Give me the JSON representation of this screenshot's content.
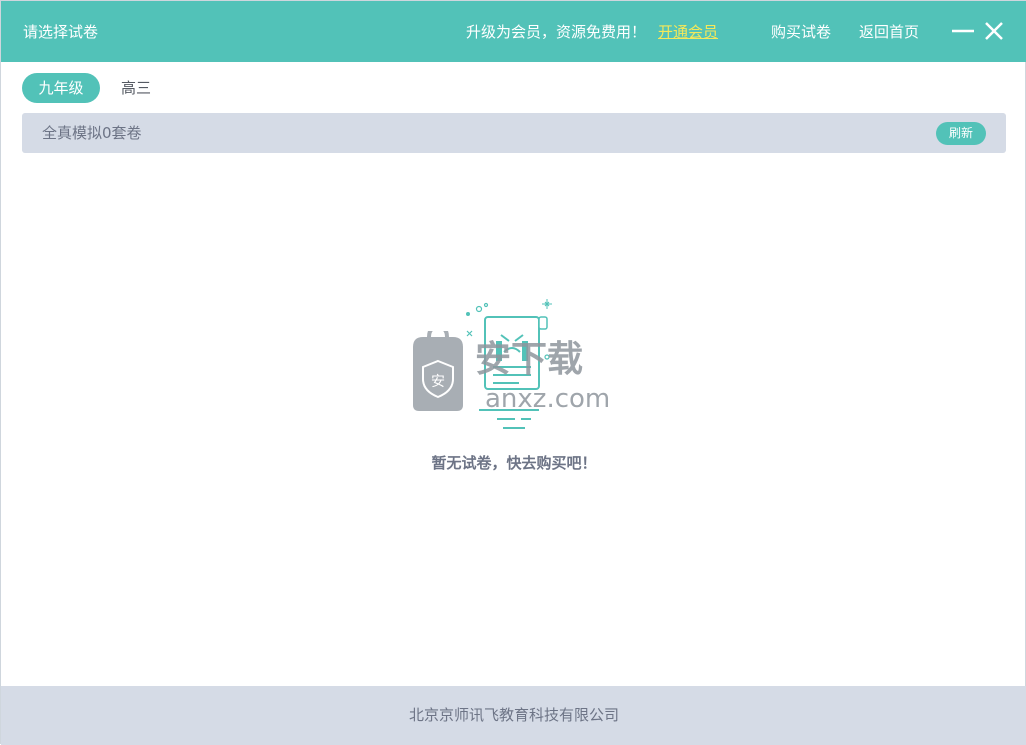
{
  "window": {
    "title": "请选择试卷",
    "promo_text": "升级为会员，资源免费用！",
    "vip_link": "开通会员",
    "nav": {
      "buy": "购买试卷",
      "home": "返回首页"
    },
    "accent_color": "#52c2b8",
    "link_color": "#f4e85a"
  },
  "grade_tabs": [
    {
      "label": "九年级",
      "active": true
    },
    {
      "label": "高三",
      "active": false
    }
  ],
  "filter": {
    "label": "全真模拟0套卷",
    "refresh_label": "刷新"
  },
  "empty_state": {
    "message": "暂无试卷，快去购买吧！",
    "icon": "empty-paper-illustration"
  },
  "watermark": {
    "badge": "安",
    "text_top": "安下载",
    "text_bottom": "anxz.com"
  },
  "footer": {
    "company": "北京京师讯飞教育科技有限公司"
  }
}
